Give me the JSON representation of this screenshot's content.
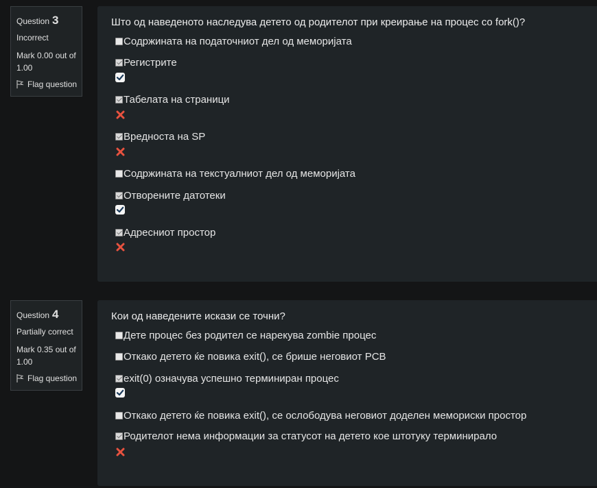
{
  "q3": {
    "label": "Question",
    "number": "3",
    "state": "Incorrect",
    "grade": "Mark 0.00 out of 1.00",
    "flag_label": "Flag question",
    "text": "Што од наведеното наследува детето од родителот при креирање на процес со fork()?",
    "options": [
      {
        "label": "Содржината на податочниот дел од меморијата",
        "checked": false,
        "feedback": ""
      },
      {
        "label": "Регистрите",
        "checked": true,
        "feedback": "correct"
      },
      {
        "label": "Табелата на страници",
        "checked": true,
        "feedback": "incorrect"
      },
      {
        "label": "Вредноста на SP",
        "checked": true,
        "feedback": "incorrect"
      },
      {
        "label": "Содржината на текстуалниот дел од меморијата",
        "checked": false,
        "feedback": ""
      },
      {
        "label": "Отворените датотеки",
        "checked": true,
        "feedback": "correct"
      },
      {
        "label": "Адресниот простор",
        "checked": true,
        "feedback": "incorrect"
      }
    ]
  },
  "q4": {
    "label": "Question",
    "number": "4",
    "state": "Partially correct",
    "grade": "Mark 0.35 out of 1.00",
    "flag_label": "Flag question",
    "text": "Кои од наведените искази се точни?",
    "options": [
      {
        "label": "Дете процес без родител се нарекува zombie процес",
        "checked": false,
        "feedback": ""
      },
      {
        "label": "Откако детето ќе повика exit(), се брише неговиот PCB",
        "checked": false,
        "feedback": ""
      },
      {
        "label": "exit(0) означува успешно терминиран процес",
        "checked": true,
        "feedback": "correct"
      },
      {
        "label": "Откако детето ќе повика exit(), се ослободува неговиот доделен мемориски простор",
        "checked": false,
        "feedback": ""
      },
      {
        "label": "Родителот нема информации за статусот на детето кое штотуку терминирало",
        "checked": true,
        "feedback": "incorrect"
      }
    ]
  },
  "colors": {
    "correct_tick": "#1a3a5a",
    "incorrect_cross": "#e8523f"
  }
}
